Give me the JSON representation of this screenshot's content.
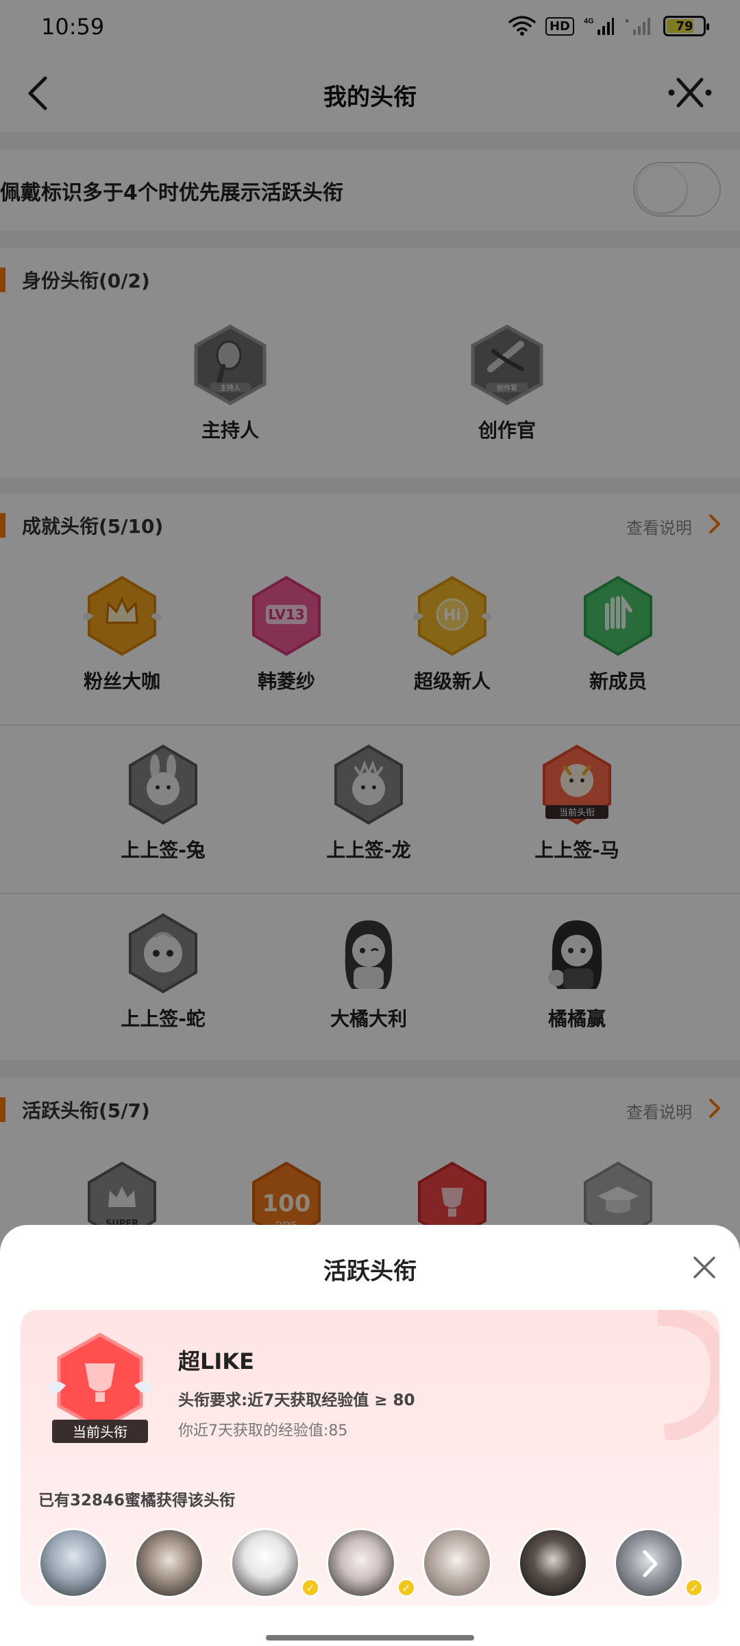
{
  "status_bar": {
    "time": "10:59",
    "network_badge": "HD",
    "signal": "4G",
    "battery": "79"
  },
  "header": {
    "title": "我的头衔"
  },
  "toggle": {
    "label": "佩戴标识多于4个时优先展示活跃头衔",
    "state": "off"
  },
  "identity": {
    "title": "身份头衔(0/2)",
    "items": [
      {
        "label": "主持人",
        "icon": "microphone-badge-icon",
        "badge_text": "主持人"
      },
      {
        "label": "创作官",
        "icon": "creator-badge-icon",
        "badge_text": "创作官"
      }
    ]
  },
  "achievement": {
    "title": "成就头衔(5/10)",
    "see_more": "查看说明",
    "rows": [
      [
        {
          "label": "粉丝大咖",
          "icon": "crown-badge-icon"
        },
        {
          "label": "韩菱纱",
          "icon": "lv13-badge-icon",
          "badge_text": "LV13"
        },
        {
          "label": "超级新人",
          "icon": "hi-badge-icon",
          "badge_text": "Hi"
        },
        {
          "label": "新成员",
          "icon": "hand-badge-icon"
        }
      ],
      [
        {
          "label": "上上签-兔",
          "icon": "rabbit-badge-icon"
        },
        {
          "label": "上上签-龙",
          "icon": "dragon-badge-icon"
        },
        {
          "label": "上上签-马",
          "icon": "horse-badge-icon",
          "badge_text": "当前头衔"
        }
      ],
      [
        {
          "label": "上上签-蛇",
          "icon": "snake-badge-icon"
        },
        {
          "label": "大橘大利",
          "icon": "girl-badge-icon"
        },
        {
          "label": "橘橘赢",
          "icon": "girl-badge-icon"
        }
      ]
    ]
  },
  "active": {
    "title": "活跃头衔(5/7)",
    "see_more": "查看说明",
    "items": [
      {
        "icon": "super-crown-badge-icon",
        "badge_text": "SUPER"
      },
      {
        "icon": "100-days-badge-icon",
        "badge_text": "DAYS"
      },
      {
        "icon": "trophy-badge-icon"
      },
      {
        "icon": "graduation-cap-badge-icon"
      }
    ]
  },
  "sheet": {
    "title": "活跃头衔",
    "badge_name": "超LIKE",
    "current_tag": "当前头衔",
    "requirement": "头衔要求:近7天获取经验值 ≥ 80",
    "your_exp": "你近7天获取的经验值:85",
    "owners": "已有32846蜜橘获得该头衔",
    "avatars": [
      {
        "verified": false,
        "icon": "avatar"
      },
      {
        "verified": false,
        "icon": "avatar"
      },
      {
        "verified": true,
        "icon": "avatar"
      },
      {
        "verified": true,
        "icon": "avatar"
      },
      {
        "verified": false,
        "icon": "avatar"
      },
      {
        "verified": false,
        "icon": "avatar"
      },
      {
        "verified": true,
        "icon": "avatar",
        "more": true
      }
    ]
  },
  "colors": {
    "accent": "#ff7a00",
    "card_bg": "#ffe8e8",
    "current_badge": "#ff5a5a",
    "verified": "#f5c518"
  }
}
